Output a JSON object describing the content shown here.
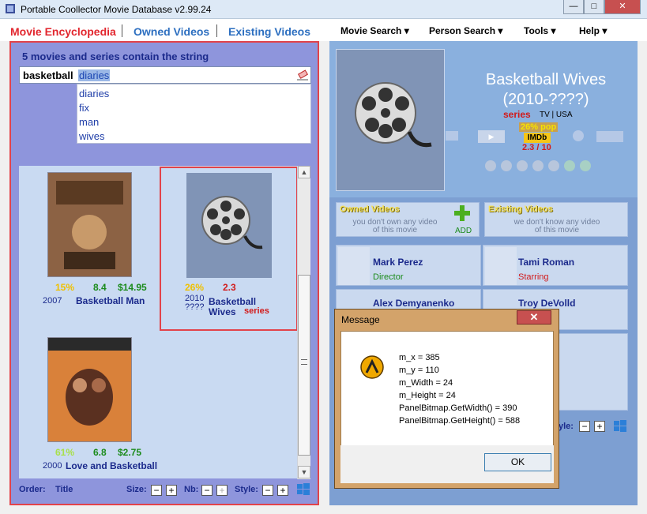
{
  "window": {
    "title": "Portable Coollector Movie Database  v2.99.24",
    "min": "—",
    "max": "□",
    "close": "✕"
  },
  "tabs": [
    {
      "label": "Movie Encyclopedia",
      "color": "#e2262e"
    },
    {
      "label": "Owned Videos",
      "color": "#2d6fc0"
    },
    {
      "label": "Existing Videos",
      "color": "#2d6fc0"
    }
  ],
  "menus": [
    "Movie Search ▾",
    "Person Search ▾",
    "Tools ▾",
    "Help ▾"
  ],
  "search": {
    "header": "5 movies and series contain the string",
    "label": "basketball",
    "value": "diaries",
    "suggestions": [
      "diaries",
      "fix",
      "man",
      "wives"
    ]
  },
  "results": [
    {
      "pct": "15%",
      "score": "8.4",
      "price": "$14.95",
      "year": "2007",
      "title": "Basketball Man"
    },
    {
      "pct": "26%",
      "score": "2.3",
      "year": "2010\n????",
      "title": "Basketball Wives",
      "badge": "series"
    },
    {
      "pct": "61%",
      "score": "6.8",
      "price": "$2.75",
      "year": "2000",
      "title": "Love and Basketball"
    }
  ],
  "footer": {
    "order_label": "Order:",
    "order_value": "Title",
    "size_label": "Size:",
    "nb_label": "Nb:",
    "style_label": "Style:",
    "minus": "−",
    "plus": "+"
  },
  "detail": {
    "title": "Basketball Wives",
    "years": "(2010-????)",
    "kind": "series",
    "country": "TV | USA",
    "pop": "26% pop",
    "imdb": "IMDb",
    "rating": "2.3 / 10",
    "owned_head": "Owned Videos",
    "owned_text": "you don't own any video\nof this movie",
    "add_label": "ADD",
    "existing_head": "Existing Videos",
    "existing_text": "we don't know any video\nof this movie",
    "style_label": "yle:",
    "people": [
      {
        "name": "Mark Perez",
        "role": "Director",
        "role_color": "#1b8b1b"
      },
      {
        "name": "Tami Roman",
        "role": "Starring",
        "role_color": "#d21a1a"
      },
      {
        "name": "Alex Demyanenko",
        "role": ""
      },
      {
        "name": "Troy DeVolld",
        "role": ""
      }
    ]
  },
  "dialog": {
    "title": "Message",
    "lines": [
      "m_x = 385",
      "m_y = 110",
      "m_Width = 24",
      "m_Height = 24",
      "PanelBitmap.GetWidth() = 390",
      "PanelBitmap.GetHeight() = 588"
    ],
    "ok": "OK",
    "close": "✕"
  }
}
